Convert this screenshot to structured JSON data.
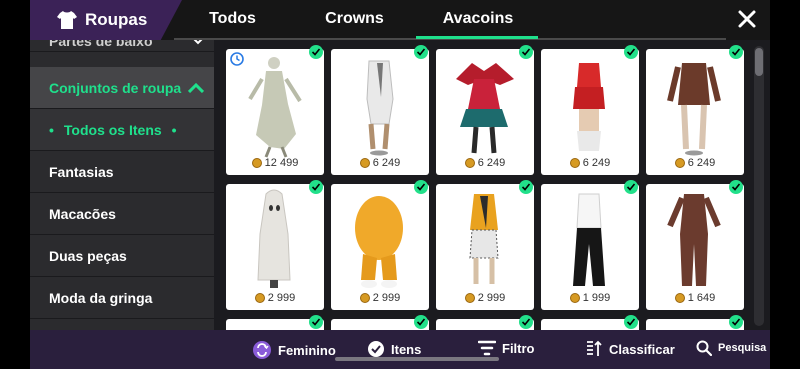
{
  "header": {
    "title": "Roupas",
    "tabs": [
      {
        "label": "Todos"
      },
      {
        "label": "Crowns"
      },
      {
        "label": "Avacoins",
        "active": true
      }
    ]
  },
  "sidebar": {
    "items": [
      {
        "label": "Partes de baixo"
      },
      {
        "label": "Conjuntos de roupa",
        "expanded": true
      },
      {
        "label": "Todos os Itens",
        "selected": true
      },
      {
        "label": "Fantasias"
      },
      {
        "label": "Macacões"
      },
      {
        "label": "Duas peças"
      },
      {
        "label": "Moda da gringa"
      }
    ]
  },
  "grid": {
    "items": [
      {
        "price": "12 499",
        "owned": true,
        "limited": true
      },
      {
        "price": "6 249",
        "owned": true
      },
      {
        "price": "6 249",
        "owned": true
      },
      {
        "price": "6 249",
        "owned": true
      },
      {
        "price": "6 249",
        "owned": true
      },
      {
        "price": "2 999",
        "owned": true
      },
      {
        "price": "2 999",
        "owned": true
      },
      {
        "price": "2 999",
        "owned": true
      },
      {
        "price": "1 999",
        "owned": true
      },
      {
        "price": "1 649",
        "owned": true
      }
    ]
  },
  "toolbar": {
    "feminino": "Feminino",
    "itens": "Itens",
    "filtro": "Filtro",
    "classificar": "Classificar",
    "pesquisa": "Pesquisa"
  },
  "colors": {
    "accent": "#1fe08c",
    "header_purple": "#3b2257",
    "bottom_bar": "#2a1f3d",
    "coin": "#d69a23"
  }
}
